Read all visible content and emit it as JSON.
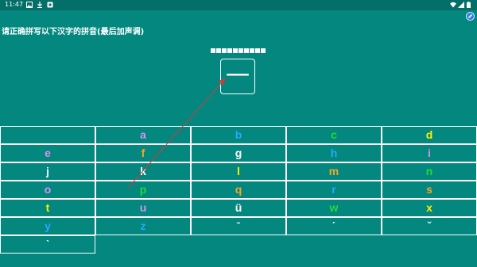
{
  "status_bar": {
    "time": "11:47",
    "left_icons": [
      "gallery-icon",
      "download-icon",
      "app-notification-icon"
    ],
    "right_icons": [
      "wifi-icon",
      "signal-icon",
      "battery-icon"
    ]
  },
  "corner_button": {
    "icon": "edit-icon"
  },
  "instruction": "请正确拼写以下汉字的拼音(最后加声调)",
  "answer_slots": 10,
  "target_character": "一",
  "keyboard": {
    "rows": [
      [
        {
          "label": "",
          "color": "#ffffff"
        },
        {
          "label": "a",
          "color": "#d592f0"
        },
        {
          "label": "b",
          "color": "#22aaff"
        },
        {
          "label": "c",
          "color": "#22dd33"
        },
        {
          "label": "d",
          "color": "#ffee00"
        }
      ],
      [
        {
          "label": "e",
          "color": "#d592f0"
        },
        {
          "label": "f",
          "color": "#f5a623"
        },
        {
          "label": "g",
          "color": "#ffffff"
        },
        {
          "label": "h",
          "color": "#22aaff"
        },
        {
          "label": "i",
          "color": "#d592f0"
        }
      ],
      [
        {
          "label": "j",
          "color": "#ffffff"
        },
        {
          "label": "k",
          "color": "#ffffff"
        },
        {
          "label": "l",
          "color": "#ffee00"
        },
        {
          "label": "m",
          "color": "#f5a623"
        },
        {
          "label": "n",
          "color": "#22dd33"
        }
      ],
      [
        {
          "label": "o",
          "color": "#d592f0"
        },
        {
          "label": "p",
          "color": "#22dd33"
        },
        {
          "label": "q",
          "color": "#f5a623"
        },
        {
          "label": "r",
          "color": "#22aaff"
        },
        {
          "label": "s",
          "color": "#f5a623"
        }
      ],
      [
        {
          "label": "t",
          "color": "#ffee00"
        },
        {
          "label": "u",
          "color": "#d592f0"
        },
        {
          "label": "ü",
          "color": "#ffffff"
        },
        {
          "label": "w",
          "color": "#22dd33"
        },
        {
          "label": "x",
          "color": "#ffee00"
        }
      ],
      [
        {
          "label": "y",
          "color": "#22aaff"
        },
        {
          "label": "z",
          "color": "#22aaff"
        },
        {
          "label": "ˉ",
          "color": "#ffffff"
        },
        {
          "label": "ˊ",
          "color": "#ffffff"
        },
        {
          "label": "ˇ",
          "color": "#ffffff"
        }
      ],
      [
        {
          "label": "ˋ",
          "color": "#ffffff"
        }
      ]
    ]
  },
  "colors": {
    "background": "#03877f",
    "status_bar": "#046f68",
    "stroke_arrow": "#d23b3b"
  }
}
